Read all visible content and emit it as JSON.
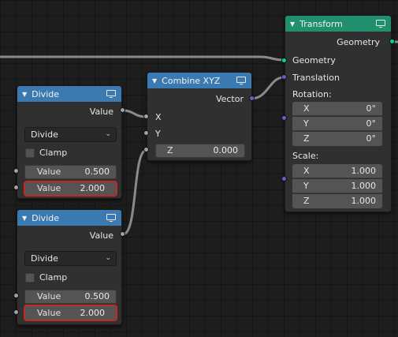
{
  "divide_node_1": {
    "title": "Divide",
    "output": "Value",
    "operation": "Divide",
    "clamp_label": "Clamp",
    "input1": {
      "label": "Value",
      "value": "0.500"
    },
    "input2": {
      "label": "Value",
      "value": "2.000"
    }
  },
  "divide_node_2": {
    "title": "Divide",
    "output": "Value",
    "operation": "Divide",
    "clamp_label": "Clamp",
    "input1": {
      "label": "Value",
      "value": "0.500"
    },
    "input2": {
      "label": "Value",
      "value": "2.000"
    }
  },
  "combine_node": {
    "title": "Combine XYZ",
    "output": "Vector",
    "x_label": "X",
    "y_label": "Y",
    "z": {
      "label": "Z",
      "value": "0.000"
    }
  },
  "transform_node": {
    "title": "Transform",
    "output": "Geometry",
    "input_geometry": "Geometry",
    "translation": "Translation",
    "rotation_label": "Rotation:",
    "rotation": [
      {
        "label": "X",
        "value": "0°"
      },
      {
        "label": "Y",
        "value": "0°"
      },
      {
        "label": "Z",
        "value": "0°"
      }
    ],
    "scale_label": "Scale:",
    "scale": [
      {
        "label": "X",
        "value": "1.000"
      },
      {
        "label": "Y",
        "value": "1.000"
      },
      {
        "label": "Z",
        "value": "1.000"
      }
    ]
  },
  "colors": {
    "header_math": "#3b7ab0",
    "header_geometry": "#1f8f6e",
    "socket_float": "#a1a1a1",
    "socket_vector": "#6363c7",
    "socket_geometry": "#00d6a3",
    "highlight": "#c22a2a"
  }
}
